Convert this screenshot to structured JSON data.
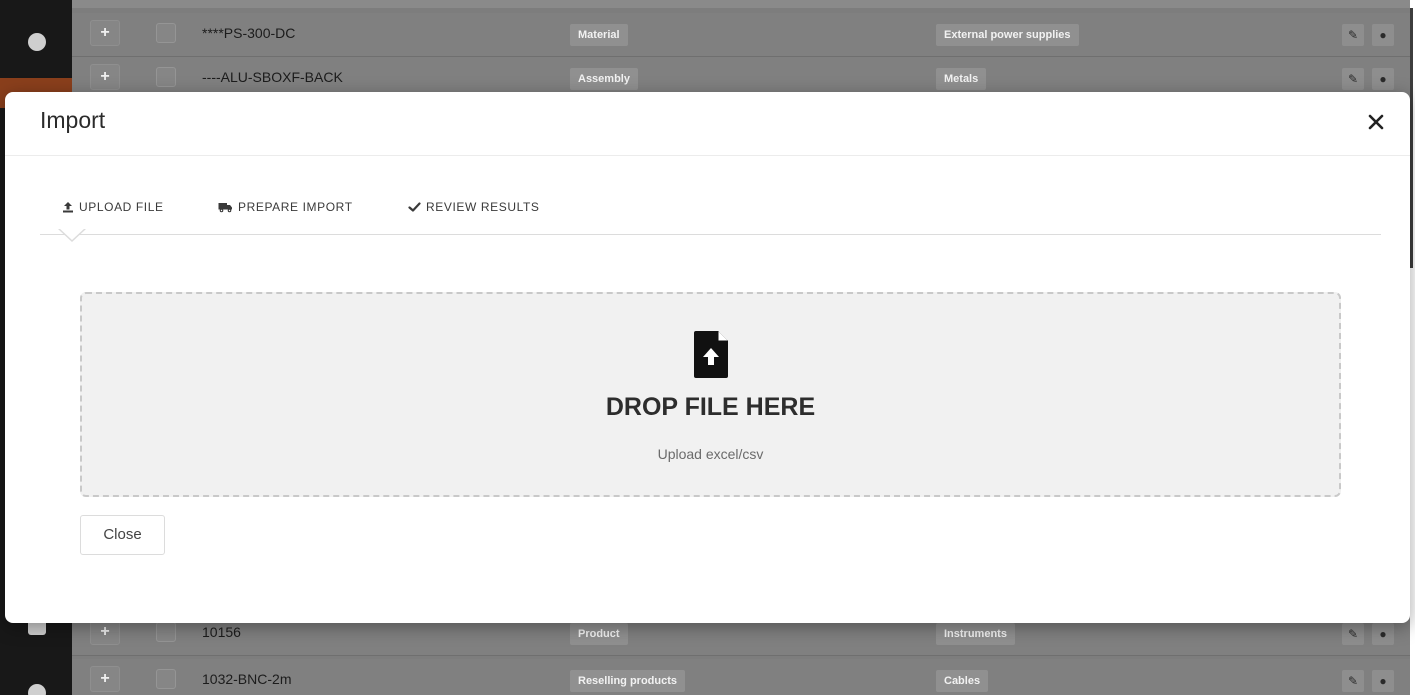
{
  "background_table": {
    "rows": [
      {
        "sku": "****PS-300-DC",
        "type": "Material",
        "category": "External power supplies",
        "expand": "+"
      },
      {
        "sku": "----ALU-SBOXF-BACK",
        "type": "Assembly",
        "category": "Metals",
        "expand": "+"
      },
      {
        "sku": "10156",
        "type": "Product",
        "category": "Instruments",
        "expand": "+"
      },
      {
        "sku": "1032-BNC-2m",
        "type": "Reselling products",
        "category": "Cables",
        "expand": "+"
      }
    ]
  },
  "modal": {
    "title": "Import",
    "tabs": [
      {
        "label": "UPLOAD FILE",
        "icon": "upload-icon",
        "active": true
      },
      {
        "label": "PREPARE IMPORT",
        "icon": "truck-icon",
        "active": false
      },
      {
        "label": "REVIEW RESULTS",
        "icon": "check-icon",
        "active": false
      }
    ],
    "dropzone": {
      "icon": "file-upload-icon",
      "title": "DROP FILE HERE",
      "subtitle": "Upload excel/csv"
    },
    "close_button": "Close"
  },
  "colors": {
    "sidebar_bg": "#181818",
    "sidebar_active": "#8a3f1c",
    "overlay_table": "#808080",
    "dropzone_bg": "#f1f1f1",
    "text_dark": "#2d2d2d"
  }
}
